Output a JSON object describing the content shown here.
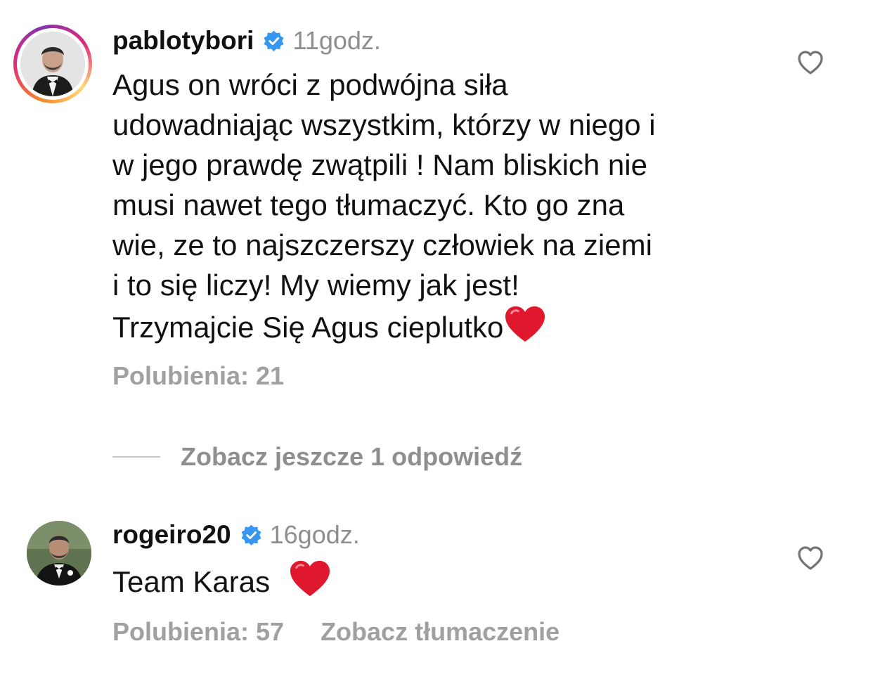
{
  "comments": [
    {
      "username": "pablotybori",
      "time": "11godz.",
      "text_lines": [
        "Agus on wróci z podwójna siła",
        "udowadniając wszystkim, którzy w niego i",
        "w jego prawdę zwątpili ! Nam bliskich nie",
        "musi nawet tego tłumaczyć. Kto go zna",
        "wie, ze to najszczerszy człowiek na ziemi",
        "i to się liczy! My wiemy jak jest!",
        "Trzymajcie Się Agus cieplutko"
      ],
      "likes_label": "Polubienia: 21",
      "replies_label": "Zobacz jeszcze 1 odpowiedź"
    },
    {
      "username": "rogeiro20",
      "time": "16godz.",
      "text": "Team Karas",
      "likes_label": "Polubienia: 57",
      "translate_label": "Zobacz tłumaczenie"
    }
  ],
  "colors": {
    "verified": "#3797f0",
    "heart_emoji": "#e0182d",
    "meta_text": "#a0a0a0"
  },
  "icons": [
    "verified-badge-icon",
    "heart-outline-icon",
    "red-heart-emoji"
  ]
}
